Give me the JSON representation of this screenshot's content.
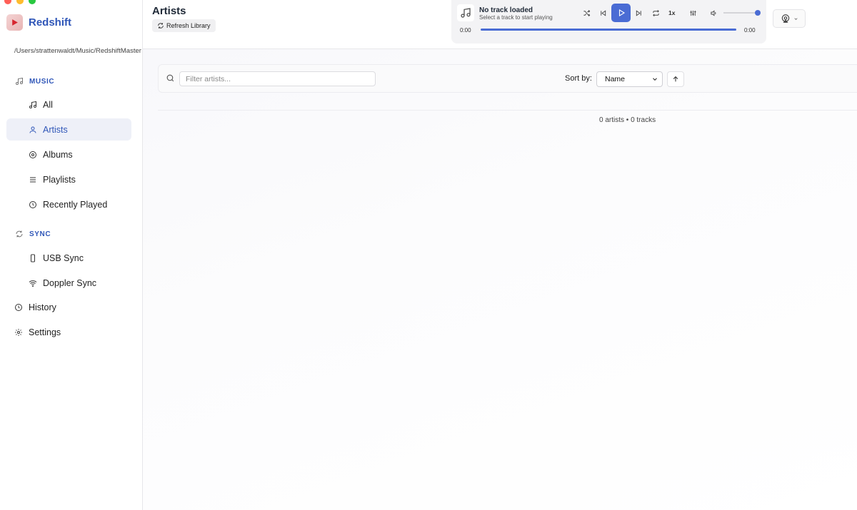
{
  "app": {
    "name": "Redshift",
    "library_path": "/Users/strattenwaldt/Music/RedshiftMaster"
  },
  "sidebar": {
    "music_section": "MUSIC",
    "music_items": [
      {
        "label": "All",
        "icon": "music-note-icon"
      },
      {
        "label": "Artists",
        "icon": "user-icon",
        "active": true
      },
      {
        "label": "Albums",
        "icon": "disc-icon"
      },
      {
        "label": "Playlists",
        "icon": "list-icon"
      },
      {
        "label": "Recently Played",
        "icon": "clock-icon"
      }
    ],
    "sync_section": "SYNC",
    "sync_items": [
      {
        "label": "USB Sync",
        "icon": "phone-icon"
      },
      {
        "label": "Doppler Sync",
        "icon": "wifi-icon"
      }
    ],
    "history": "History",
    "settings": "Settings"
  },
  "header": {
    "title": "Artists",
    "refresh_label": "Refresh Library"
  },
  "player": {
    "title": "No track loaded",
    "subtitle": "Select a track to start playing",
    "elapsed": "0:00",
    "duration": "0:00",
    "speed": "1x",
    "volume": 1.0,
    "progress": 1.0
  },
  "toolbar": {
    "search_placeholder": "Filter artists...",
    "sort_label": "Sort by:",
    "sort_value": "Name"
  },
  "summary": "0 artists • 0 tracks",
  "colors": {
    "accent": "#4a6cd4",
    "brand": "#2f56b8",
    "active_bg": "#eef0f8"
  }
}
